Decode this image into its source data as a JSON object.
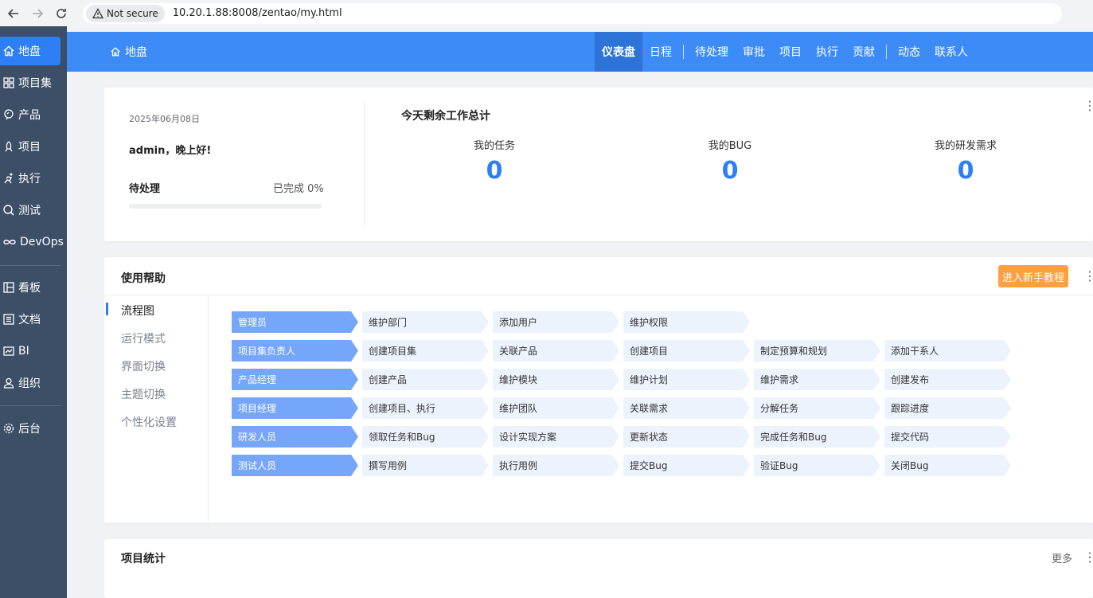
{
  "browser": {
    "security_label": "Not secure",
    "url": "10.20.1.88:8008/zentao/my.html"
  },
  "sidebar": {
    "items": [
      {
        "label": "地盘",
        "icon": "home-icon"
      },
      {
        "label": "项目集",
        "icon": "grid-icon"
      },
      {
        "label": "产品",
        "icon": "product-icon"
      },
      {
        "label": "项目",
        "icon": "project-icon"
      },
      {
        "label": "执行",
        "icon": "run-icon"
      },
      {
        "label": "测试",
        "icon": "test-icon"
      },
      {
        "label": "DevOps",
        "icon": "infinity-icon"
      },
      {
        "label": "看板",
        "icon": "kanban-icon"
      },
      {
        "label": "文档",
        "icon": "doc-icon"
      },
      {
        "label": "BI",
        "icon": "chart-icon"
      },
      {
        "label": "组织",
        "icon": "user-icon"
      },
      {
        "label": "后台",
        "icon": "gear-icon"
      }
    ]
  },
  "header": {
    "title": "地盘",
    "tabs": [
      "仪表盘",
      "日程",
      "待处理",
      "审批",
      "项目",
      "执行",
      "贡献",
      "动态",
      "联系人"
    ],
    "active_tab": "仪表盘"
  },
  "welcome": {
    "date": "2025年06月08日",
    "greeting": "admin，晚上好!",
    "pending_label": "待处理",
    "done_label": "已完成 0%",
    "progress_fraction": 0
  },
  "today_stats": {
    "title": "今天剩余工作总计",
    "items": [
      {
        "label": "我的任务",
        "value": "0"
      },
      {
        "label": "我的BUG",
        "value": "0"
      },
      {
        "label": "我的研发需求",
        "value": "0"
      }
    ]
  },
  "help": {
    "title": "使用帮助",
    "tutorial_button": "进入新手教程",
    "nav": [
      "流程图",
      "运行模式",
      "界面切换",
      "主题切换",
      "个性化设置"
    ],
    "active_nav": "流程图",
    "flow": [
      {
        "role": "管理员",
        "steps": [
          "维护部门",
          "添加用户",
          "维护权限"
        ]
      },
      {
        "role": "项目集负责人",
        "steps": [
          "创建项目集",
          "关联产品",
          "创建项目",
          "制定预算和规划",
          "添加干系人"
        ]
      },
      {
        "role": "产品经理",
        "steps": [
          "创建产品",
          "维护模块",
          "维护计划",
          "维护需求",
          "创建发布"
        ]
      },
      {
        "role": "项目经理",
        "steps": [
          "创建项目、执行",
          "维护团队",
          "关联需求",
          "分解任务",
          "跟踪进度"
        ]
      },
      {
        "role": "研发人员",
        "steps": [
          "领取任务和Bug",
          "设计实现方案",
          "更新状态",
          "完成任务和Bug",
          "提交代码"
        ]
      },
      {
        "role": "测试人员",
        "steps": [
          "撰写用例",
          "执行用例",
          "提交Bug",
          "验证Bug",
          "关闭Bug"
        ]
      }
    ]
  },
  "project_stats": {
    "title": "项目统计",
    "more_label": "更多"
  }
}
